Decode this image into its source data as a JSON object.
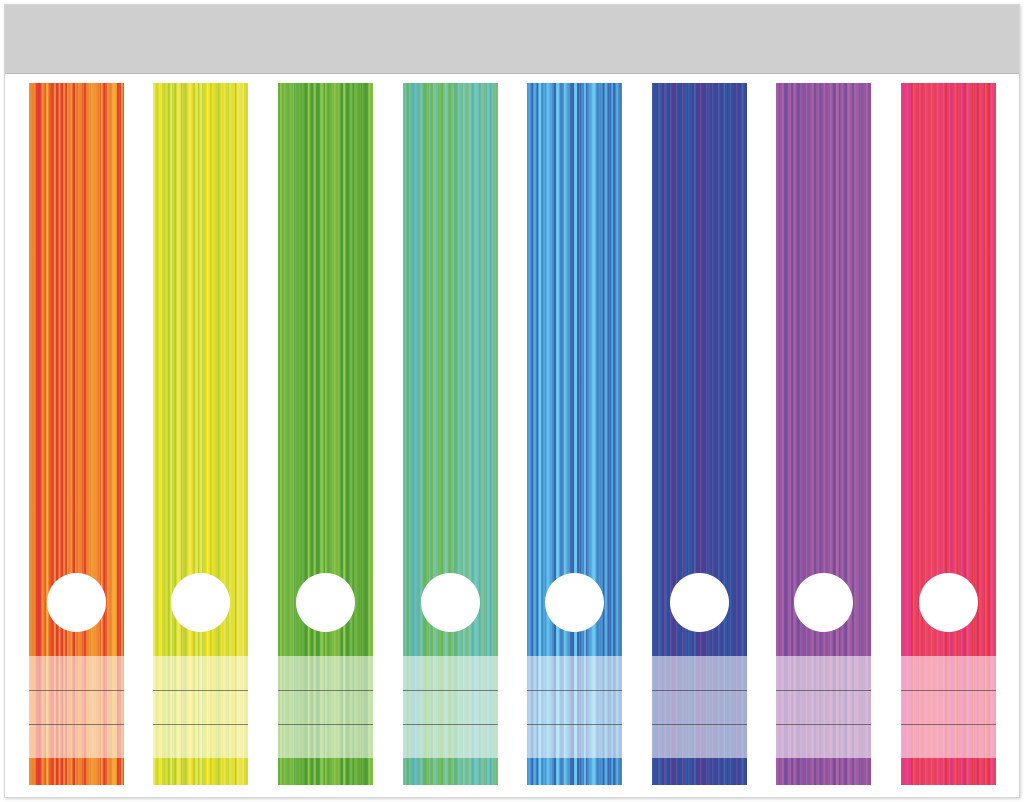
{
  "sheet": {
    "header_color": "#cfcfcf",
    "strips": [
      {
        "name": "red-orange",
        "colors": [
          "#e8392b",
          "#ef5a26",
          "#f3862a",
          "#f5a12c"
        ]
      },
      {
        "name": "yellow",
        "colors": [
          "#f2e31d",
          "#efe64a",
          "#d6df2a",
          "#b6d231"
        ]
      },
      {
        "name": "green",
        "colors": [
          "#5aaa33",
          "#70b63a",
          "#8cc63f",
          "#4d9e32"
        ]
      },
      {
        "name": "teal",
        "colors": [
          "#68b956",
          "#79c08a",
          "#6dc3b3",
          "#5ab8b0"
        ]
      },
      {
        "name": "sky-blue",
        "colors": [
          "#63c3ea",
          "#4aa8df",
          "#3f86cc",
          "#3567b3"
        ]
      },
      {
        "name": "navy",
        "colors": [
          "#2f56a8",
          "#2c4a9e",
          "#3d3f98",
          "#4a3a94"
        ]
      },
      {
        "name": "purple",
        "colors": [
          "#7b4a9e",
          "#8e4f9f",
          "#9a559f",
          "#a35aa2"
        ]
      },
      {
        "name": "pink-red",
        "colors": [
          "#e12f86",
          "#ea3a78",
          "#ef3e5e",
          "#e63244"
        ]
      }
    ],
    "hole_color": "#ffffff"
  }
}
